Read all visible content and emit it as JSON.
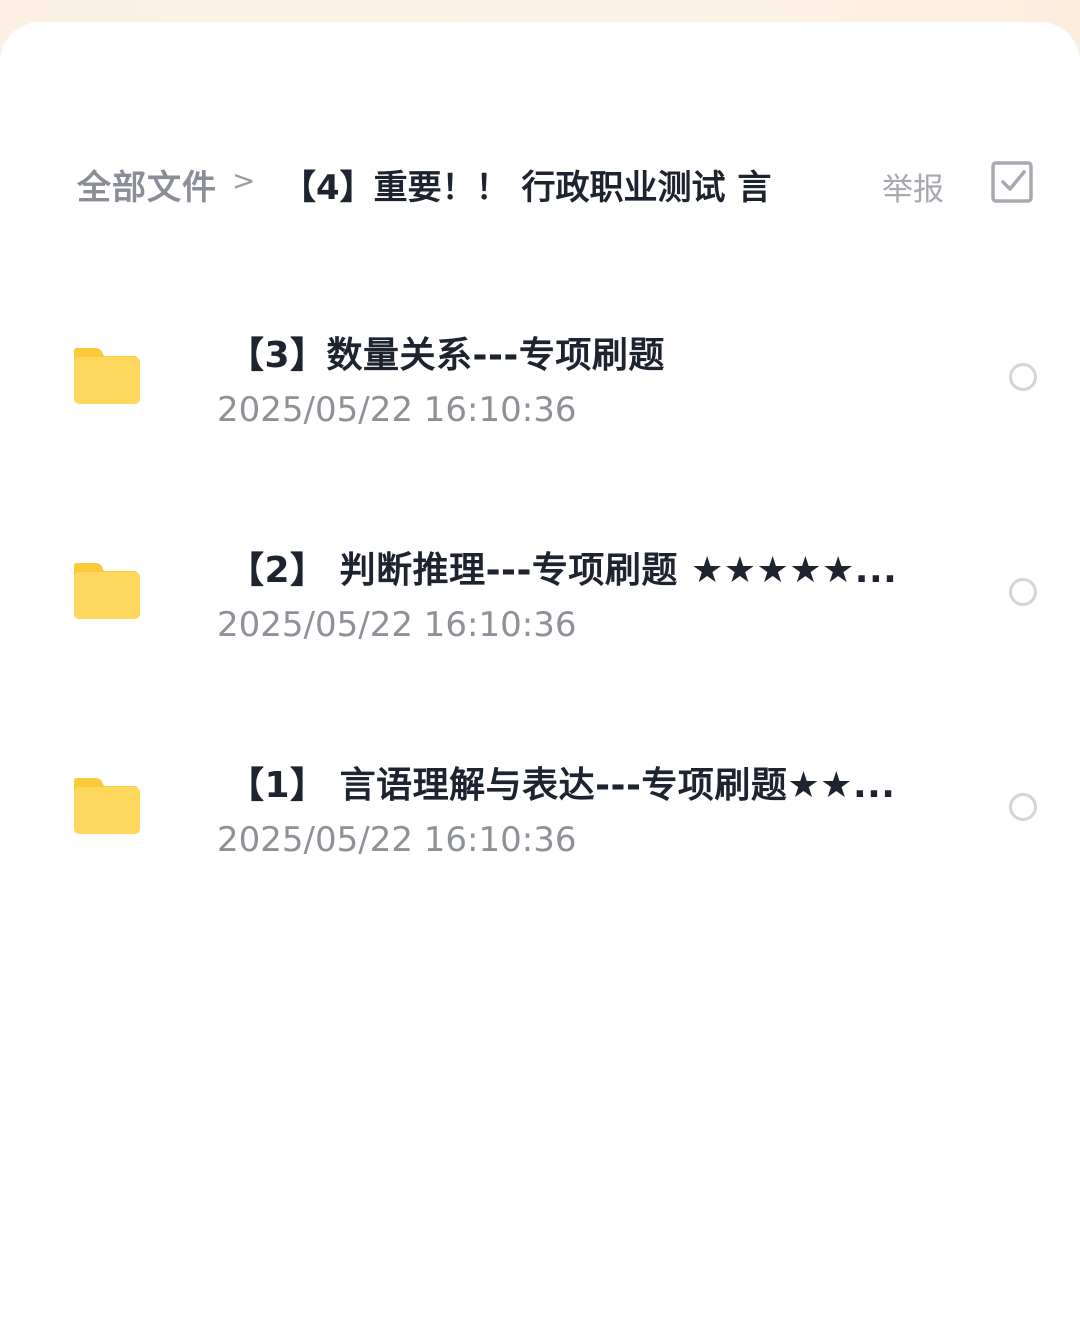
{
  "header": {
    "root_label": "全部文件",
    "separator": ">",
    "current_folder": "【4】重要！！ 行政职业测试 言",
    "report_label": "举报"
  },
  "files": [
    {
      "name": "【3】数量关系---专项刷题",
      "time": "2025/05/22 16:10:36",
      "type_icon": "folder-icon"
    },
    {
      "name": "【2】 判断推理---专项刷题 ★★★★★...",
      "time": "2025/05/22 16:10:36",
      "type_icon": "folder-icon"
    },
    {
      "name": "【1】 言语理解与表达---专项刷题★★...",
      "time": "2025/05/22 16:10:36",
      "type_icon": "folder-icon"
    }
  ],
  "colors": {
    "folder": "#fdd85c",
    "folder_tab": "#fcc93a",
    "title_text": "#1e2330",
    "secondary_text": "#8e9198"
  }
}
